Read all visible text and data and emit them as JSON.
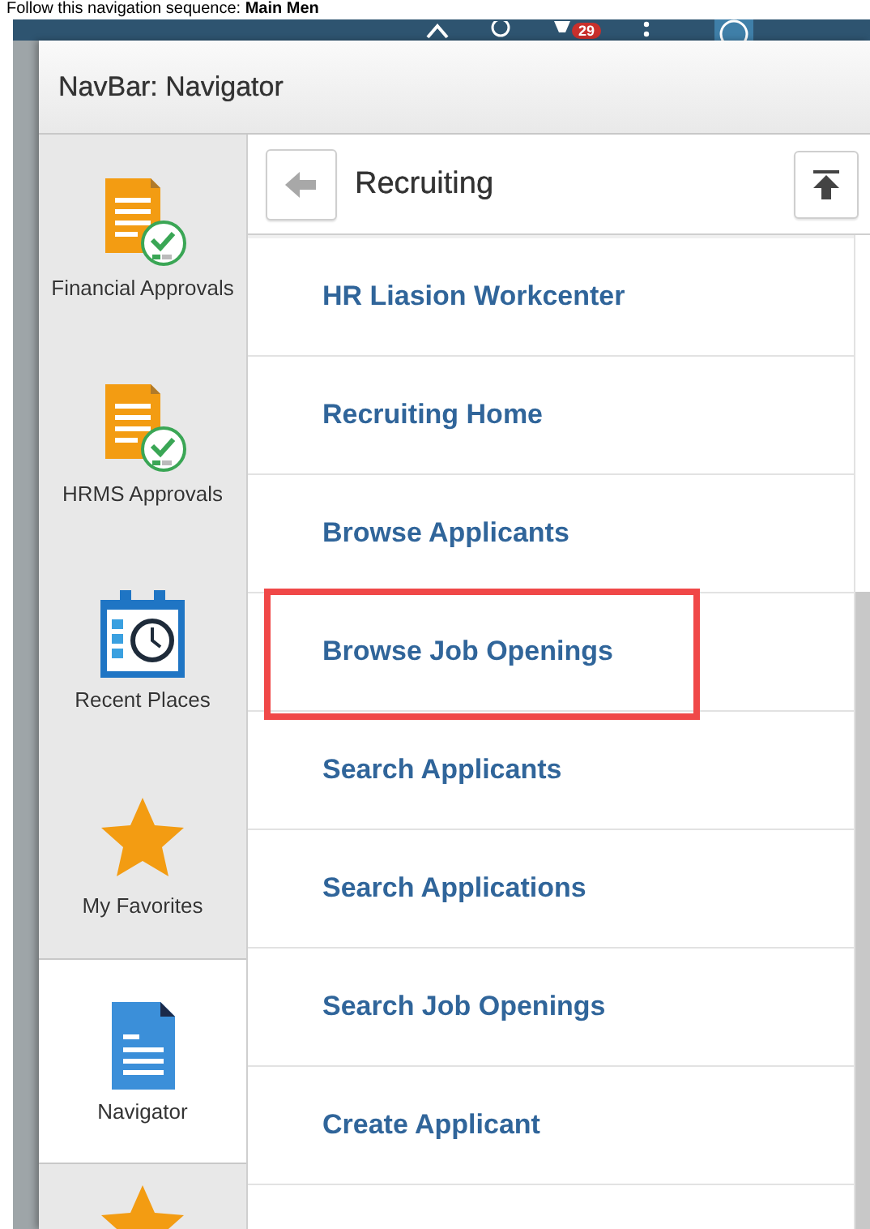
{
  "instruction": "Follow this navigation sequence: **Main Men**",
  "banner": {
    "notification_count": "29"
  },
  "dialog": {
    "title": "NavBar: Navigator"
  },
  "sidebar": {
    "items": [
      {
        "label": "Financial Approvals",
        "kind": "approval",
        "selected": false
      },
      {
        "label": "HRMS Approvals",
        "kind": "approval",
        "selected": false
      },
      {
        "label": "Recent Places",
        "kind": "calendar",
        "selected": false
      },
      {
        "label": "My Favorites",
        "kind": "star",
        "selected": false
      },
      {
        "label": "Navigator",
        "kind": "document",
        "selected": true
      },
      {
        "kind": "star",
        "selected": false
      }
    ]
  },
  "content": {
    "heading": "Recruiting",
    "items": [
      {
        "label": "HR Liasion Workcenter",
        "highlighted": false
      },
      {
        "label": "Recruiting Home",
        "highlighted": false
      },
      {
        "label": "Browse Applicants",
        "highlighted": false
      },
      {
        "label": "Browse Job Openings",
        "highlighted": true
      },
      {
        "label": "Search Applicants",
        "highlighted": false
      },
      {
        "label": "Search Applications",
        "highlighted": false
      },
      {
        "label": "Search Job Openings",
        "highlighted": false
      },
      {
        "label": "Create Applicant",
        "highlighted": false
      }
    ]
  }
}
